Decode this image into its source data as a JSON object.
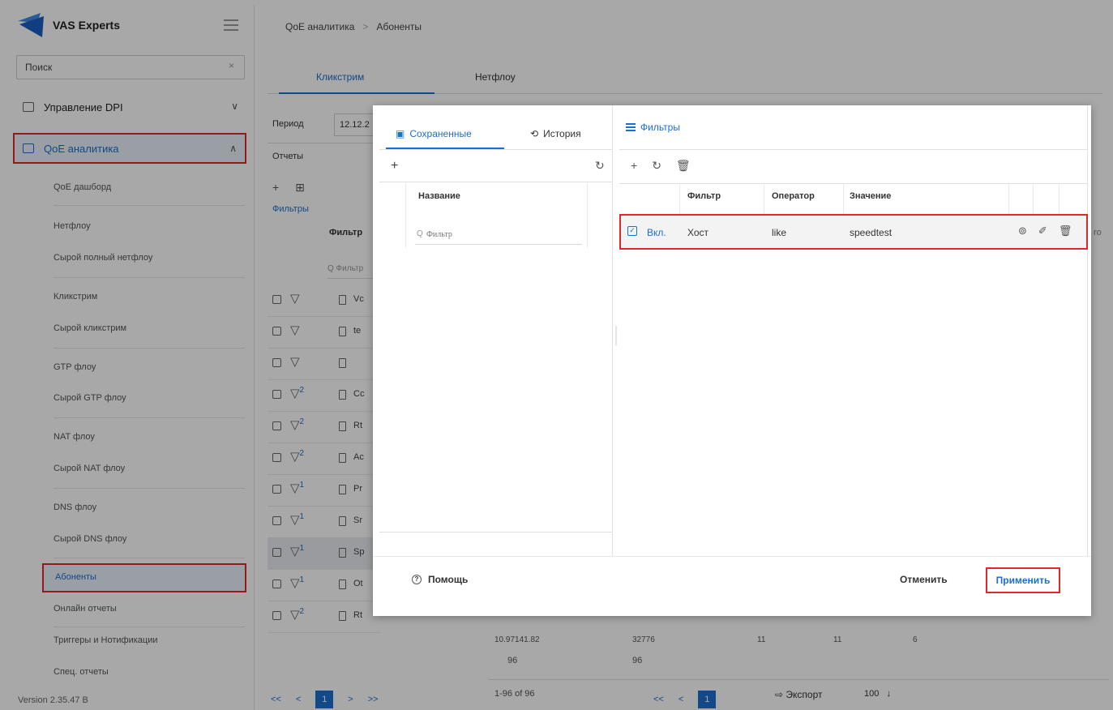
{
  "sidebar": {
    "brand": "VAS Experts",
    "search_value": "Поиск",
    "search_clear": "×",
    "groups": {
      "dpi": "Управление DPI",
      "qoe": "QoE аналитика"
    },
    "chevron_down": "∨",
    "chevron_up": "∧",
    "items": [
      "QoE дашборд",
      "Нетфлоу",
      "Сырой полный нетфлоу",
      "Кликстрим",
      "Сырой кликстрим",
      "GTP флоу",
      "Сырой GTP флоу",
      "NAT флоу",
      "Сырой NAT флоу",
      "DNS флоу",
      "Сырой DNS флоу",
      "Абоненты",
      "Онлайн отчеты",
      "Триггеры и Нотификации",
      "Спец. отчеты"
    ],
    "version": "Version 2.35.47 B"
  },
  "main": {
    "breadcrumb": [
      "QoE аналитика",
      "Абоненты"
    ],
    "breadcrumb_sep": ">",
    "tabs": [
      "Кликстрим",
      "Нетфлоу"
    ],
    "period_label": "Период",
    "period_value": "12.12.2",
    "reports_label": "Отчеты",
    "reports_tools": "+ ⊞",
    "filters_label": "Фильтры",
    "filter_col": "Фильтр",
    "filter_search": "Q Фильтр",
    "report_rows": [
      {
        "badge": "",
        "name": "Vc"
      },
      {
        "badge": "",
        "name": "te"
      },
      {
        "badge": "",
        "name": ""
      },
      {
        "badge": "2",
        "name": "Cc"
      },
      {
        "badge": "2",
        "name": "Rt"
      },
      {
        "badge": "2",
        "name": "Ac"
      },
      {
        "badge": "1",
        "name": "Pr"
      },
      {
        "badge": "1",
        "name": "Sr"
      },
      {
        "badge": "1",
        "name": "Sp"
      },
      {
        "badge": "1",
        "name": "Ot"
      },
      {
        "badge": "2",
        "name": "Rt"
      }
    ],
    "pager": {
      "first": "<<",
      "prev": "<",
      "page": "1",
      "next": ">",
      "last": ">>"
    },
    "bottom_values": [
      "10.97141.82",
      "32776",
      "11",
      "11",
      "6"
    ],
    "bottom_values2": [
      "96",
      "96"
    ],
    "count": "1-96 of 96",
    "export": "Экспорт",
    "per_page": "100",
    "per_page_arrow": "↓"
  },
  "modal": {
    "tab_saved": "Сохраненные",
    "tab_history": "История",
    "plus": "+",
    "refresh": "↻",
    "name_col": "Название",
    "filter_placeholder": "Фильтр",
    "right_title": "Фильтры",
    "tool_plus": "+",
    "tool_refresh": "↻",
    "tool_delete": "🗑",
    "columns": [
      "Фильтр",
      "Оператор",
      "Значение"
    ],
    "rule": {
      "enabled": "Вкл.",
      "field": "Хост",
      "operator": "like",
      "value": "speedtest"
    },
    "help": "Помощь",
    "cancel": "Отменить",
    "apply": "Применить"
  },
  "peek": "ro",
  "colors": {
    "accent": "#1b6fd1",
    "highlight": "#e3262c"
  }
}
